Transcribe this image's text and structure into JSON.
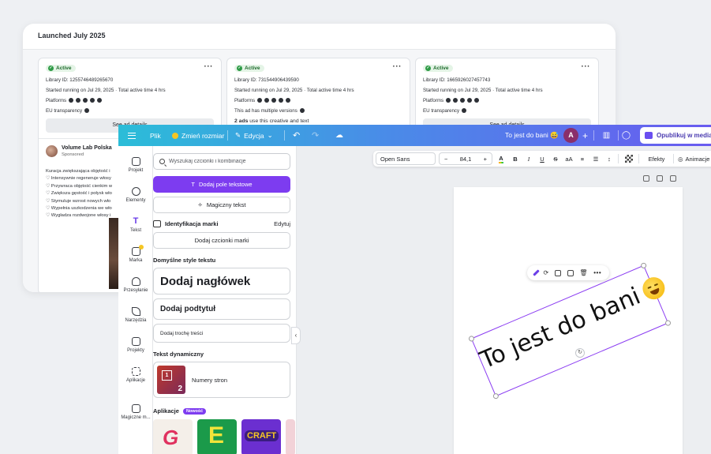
{
  "adlib": {
    "title": "Launched July 2025",
    "cards": [
      {
        "status": "Active",
        "library_id": "Library ID: 1255746489265670",
        "started": "Started running on Jul 29, 2025 · Total active time 4 hrs",
        "platforms_label": "Platforms",
        "extra": "EU transparency",
        "detail_button": "See ad details"
      },
      {
        "status": "Active",
        "library_id": "Library ID: 731544906439590",
        "started": "Started running on Jul 29, 2025 · Total active time 4 hrs",
        "platforms_label": "Platforms",
        "extra": "This ad has multiple versions",
        "versions_bold": "2 ads",
        "versions_rest": " use this creative and text"
      },
      {
        "status": "Active",
        "library_id": "Library ID: 1665926027457743",
        "started": "Started running on Jul 29, 2025 · Total active time 4 hrs",
        "platforms_label": "Platforms",
        "extra": "EU transparency",
        "detail_button": "See ad details"
      }
    ],
    "advertiser": {
      "name": "Volume Lab Polska",
      "sponsored": "Sponsored",
      "copy": [
        "Kuracja zwiększająca objętość i",
        "♡ Intensywnie regeneruje włosy",
        "♡ Przywraca objętość cienkim w",
        "♡ Zwiększa gęstość i połysk wło",
        "♡ Stymuluje wzrost nowych wło",
        "♡ Wypełnia uszkodzenia we wło",
        "♡ Wygładza rozdwojone włosy i"
      ]
    }
  },
  "topbar": {
    "file": "Plik",
    "resize": "Zmień rozmiar",
    "edit": "Edycja",
    "doc_title": "To jest do bani 😅",
    "avatar_letter": "A",
    "plus": "+",
    "publish": "Opublikuj w mediach"
  },
  "rail": [
    {
      "label": "Projekt",
      "icon": "layout-icon"
    },
    {
      "label": "Elementy",
      "icon": "shapes-icon"
    },
    {
      "label": "Tekst",
      "icon": "text-icon"
    },
    {
      "label": "Marka",
      "icon": "brand-icon"
    },
    {
      "label": "Przesyłanie",
      "icon": "upload-cloud-icon"
    },
    {
      "label": "Narzędzia",
      "icon": "pen-tool-icon"
    },
    {
      "label": "Projekty",
      "icon": "folder-icon"
    },
    {
      "label": "Aplikacje",
      "icon": "apps-grid-icon"
    },
    {
      "label": "Magiczne m...",
      "icon": "magic-image-icon"
    }
  ],
  "panel": {
    "search_placeholder": "Wyszukaj czcionki i kombinacje",
    "add_textbox": "Dodaj pole tekstowe",
    "magic_text": "Magiczny tekst",
    "brand_identity": "Identyfikacja marki",
    "brand_edit": "Edytuj",
    "add_brand_fonts": "Dodaj czcionki marki",
    "default_styles": "Domyślne style tekstu",
    "add_heading": "Dodaj nagłówek",
    "add_subheading": "Dodaj podtytuł",
    "add_body": "Dodaj trochę treści",
    "dynamic_text": "Tekst dynamiczny",
    "page_numbers": "Numery stron",
    "apps": "Aplikacje",
    "new_badge": "Nowość"
  },
  "text_toolbar": {
    "font": "Open Sans",
    "size": "84,1",
    "minus": "−",
    "plus": "+",
    "effects": "Efekty",
    "animate": "Animacje",
    "bold": "B",
    "italic": "I",
    "underline": "U",
    "strike": "S",
    "case": "aA",
    "color_letter": "A"
  },
  "canvas": {
    "text": "To jest do bani"
  },
  "colors": {
    "accent": "#7d3cf0",
    "topbar_start": "#2bbdd8",
    "topbar_end": "#6a5af0",
    "status_green": "#2e9b46"
  }
}
